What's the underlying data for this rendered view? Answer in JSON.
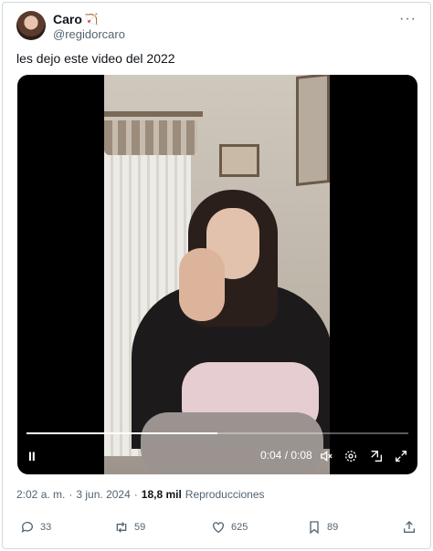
{
  "author": {
    "name": "Caro",
    "name_emoji": "🏹",
    "handle": "@regidorcaro",
    "more_icon": "more-horizontal-icon"
  },
  "tweet": {
    "text": "les dejo este video del 2022"
  },
  "video": {
    "play_label": "II",
    "time_display": "0:04 / 0:08",
    "progress": 0.5,
    "icons": [
      "play-pause-icon",
      "volume-muted-icon",
      "settings-gear-icon",
      "picture-in-picture-icon",
      "fullscreen-icon"
    ]
  },
  "meta": {
    "time": "2:02 a. m.",
    "separator": "·",
    "date": "3 jun. 2024",
    "views_count": "18,8 mil",
    "views_label": "Reproducciones"
  },
  "actions": {
    "replies": "33",
    "reposts": "59",
    "likes": "625",
    "bookmarks": "89"
  },
  "colors": {
    "text_primary": "#0f1419",
    "text_secondary": "#536471",
    "border": "#cfd9de",
    "media_background": "#000000"
  }
}
